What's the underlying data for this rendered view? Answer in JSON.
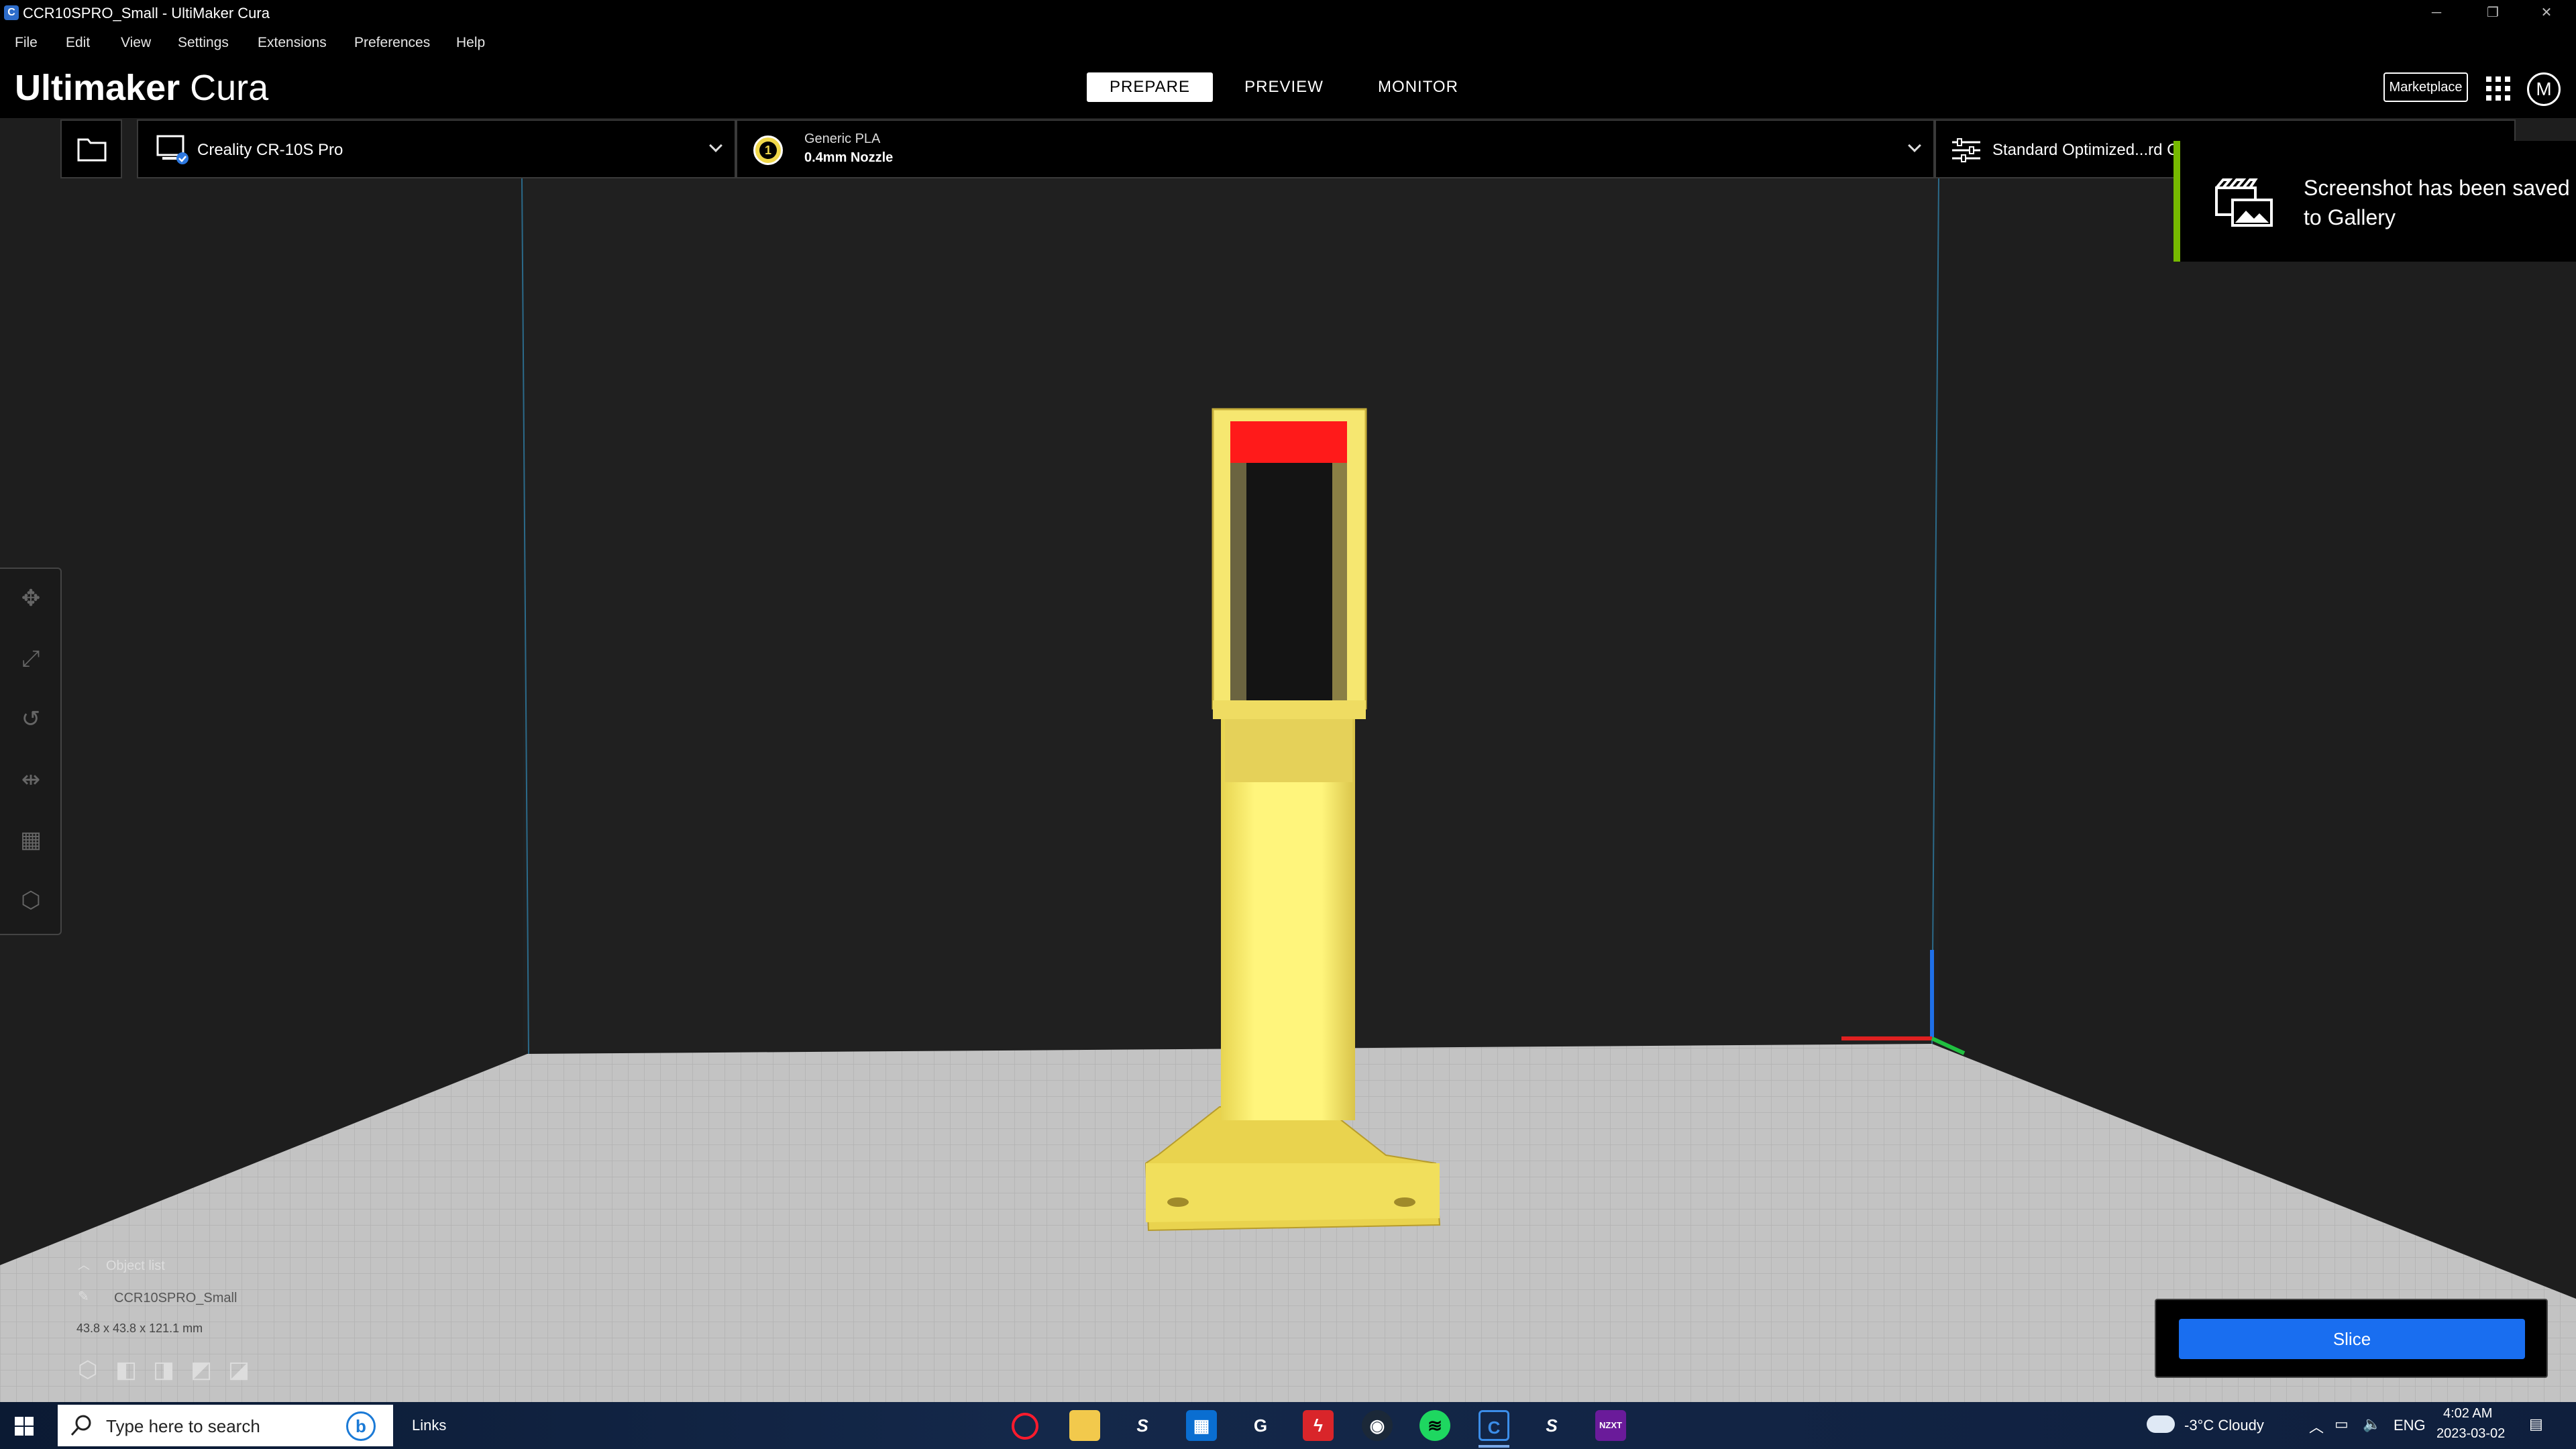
{
  "window": {
    "title": "CCR10SPRO_Small - UltiMaker Cura",
    "controls": {
      "minimize": "─",
      "restore": "❐",
      "close": "✕"
    }
  },
  "menu": [
    "File",
    "Edit",
    "View",
    "Settings",
    "Extensions",
    "Preferences",
    "Help"
  ],
  "header": {
    "brand_bold": "Ultimaker",
    "brand_light": " Cura",
    "tabs": [
      "PREPARE",
      "PREVIEW",
      "MONITOR"
    ],
    "active_tab": "PREPARE",
    "marketplace": "Marketplace",
    "avatar_initial": "M"
  },
  "stage": {
    "machine": "Creality CR-10S Pro",
    "extruder_number": "1",
    "material": "Generic PLA",
    "nozzle": "0.4mm Nozzle",
    "profile": "Standard Optimized...rd C"
  },
  "toast": {
    "message": "Screenshot has been saved to Gallery",
    "accent": "#76b900"
  },
  "object_list": {
    "toggle_label": "Object list",
    "object_name": "CCR10SPRO_Small",
    "dimensions": "43.8 x 43.8 x 121.1 mm"
  },
  "slice": {
    "label": "Slice",
    "color": "#196ef0"
  },
  "colors": {
    "model": "#fff27a",
    "model_shade": "#e8d85a",
    "overhang": "#ff1a1a",
    "plate": "#bdbdbd",
    "background": "#1e1e1e"
  },
  "taskbar": {
    "search_placeholder": "Type here to search",
    "links": "Links",
    "weather": "-3°C  Cloudy",
    "language": "ENG",
    "time": "4:02 AM",
    "date": "2023-03-02",
    "apps": [
      "opera",
      "file-explorer",
      "stacksocial",
      "store",
      "logitech",
      "flash",
      "steam",
      "spotify",
      "cura",
      "stacksocial2",
      "nzxt"
    ]
  }
}
